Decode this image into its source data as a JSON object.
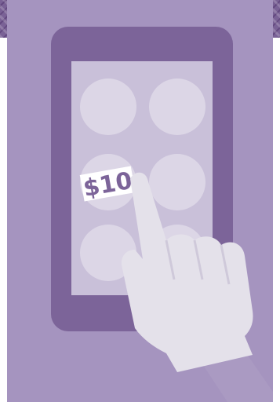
{
  "illustration": {
    "price_label": "$10",
    "colors": {
      "background_panel": "#a594bf",
      "phone_body": "#7c6499",
      "phone_screen": "#c9c0d9",
      "screen_buttons": "#dcd6e6",
      "hand": "#e4e1ea",
      "price_tag": "#ffffff",
      "price_text": "#7c6499",
      "pattern": "#7a6296"
    },
    "icons": [
      "smartphone-icon",
      "pointing-hand-icon",
      "price-tag-icon"
    ]
  }
}
